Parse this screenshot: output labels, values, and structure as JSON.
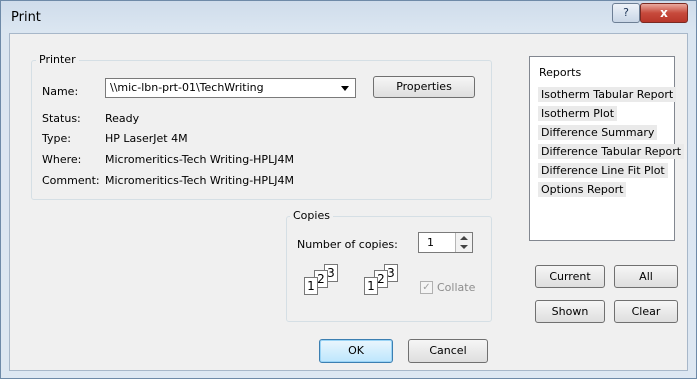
{
  "window": {
    "title": "Print",
    "help_label": "?",
    "close_label": "x"
  },
  "printer": {
    "group_label": "Printer",
    "name_label": "Name:",
    "name_value": "\\\\mic-lbn-prt-01\\TechWriting",
    "properties_label": "Properties",
    "status_label": "Status:",
    "status_value": "Ready",
    "type_label": "Type:",
    "type_value": "HP LaserJet 4M",
    "where_label": "Where:",
    "where_value": "Micromeritics-Tech Writing-HPLJ4M",
    "comment_label": "Comment:",
    "comment_value": "Micromeritics-Tech Writing-HPLJ4M"
  },
  "copies": {
    "group_label": "Copies",
    "number_label": "Number of copies:",
    "number_value": "1",
    "collate_label": "Collate",
    "collate_checked": true,
    "page_numbers": [
      "1",
      "2",
      "3"
    ]
  },
  "reports": {
    "header": "Reports",
    "items": [
      "Isotherm Tabular Report",
      "Isotherm Plot",
      "Difference Summary",
      "Difference Tabular Report",
      "Difference Line Fit Plot",
      "Options Report"
    ]
  },
  "buttons": {
    "current": "Current",
    "all": "All",
    "shown": "Shown",
    "clear": "Clear",
    "ok": "OK",
    "cancel": "Cancel"
  }
}
